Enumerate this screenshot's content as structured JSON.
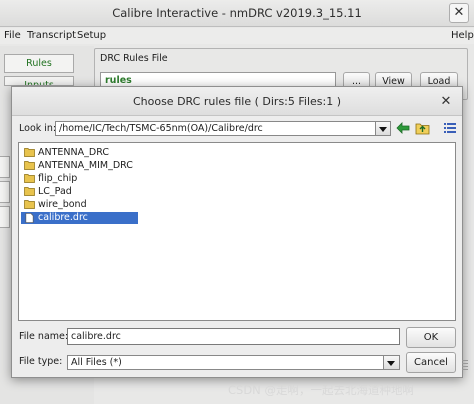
{
  "main_window": {
    "title": "Calibre Interactive - nmDRC v2019.3_15.11",
    "menu": {
      "file": "File",
      "transcript": "Transcript",
      "setup": "Setup",
      "help": "Help"
    },
    "left_tabs": [
      "Rules",
      "Inputs"
    ],
    "drc_rules_group_label": "DRC Rules File",
    "rules_field_value": "rules",
    "buttons": {
      "browse": "...",
      "view": "View",
      "load": "Load"
    }
  },
  "dialog": {
    "title": "Choose DRC rules file ( Dirs:5 Files:1 )",
    "look_in_label": "Look in:",
    "look_in_path": "/home/IC/Tech/TSMC-65nm(OA)/Calibre/drc",
    "toolbar_icons": [
      "back-arrow-icon",
      "up-folder-icon",
      "detail-view-icon"
    ],
    "entries": [
      {
        "name": "ANTENNA_DRC",
        "kind": "folder",
        "selected": false
      },
      {
        "name": "ANTENNA_MIM_DRC",
        "kind": "folder",
        "selected": false
      },
      {
        "name": "flip_chip",
        "kind": "folder",
        "selected": false
      },
      {
        "name": "LC_Pad",
        "kind": "folder",
        "selected": false
      },
      {
        "name": "wire_bond",
        "kind": "folder",
        "selected": false
      },
      {
        "name": "calibre.drc",
        "kind": "file",
        "selected": true
      }
    ],
    "file_name_label": "File name:",
    "file_name_value": "calibre.drc",
    "file_type_label": "File type:",
    "file_type_value": "All Files (*)",
    "ok_label": "OK",
    "cancel_label": "Cancel"
  },
  "watermark": "CSDN @走啊，一起去北海道种地啊",
  "colors": {
    "selection": "#3a6fc9",
    "folder": "#e8c34d",
    "rules_text": "#2e7d2e",
    "tab_text": "#207220"
  }
}
